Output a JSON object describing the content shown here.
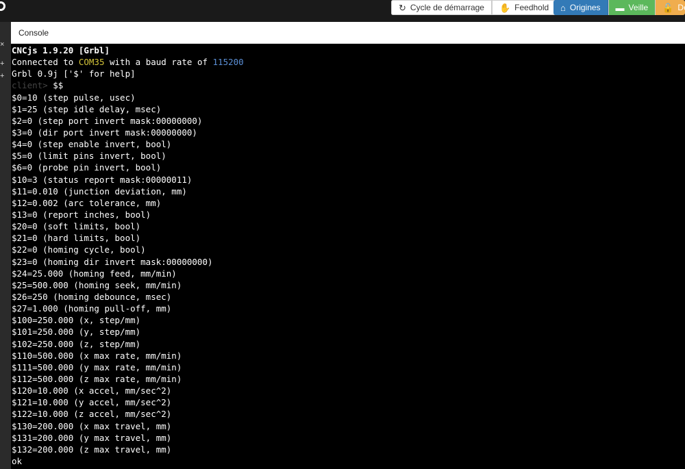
{
  "toolbar": {
    "cycle_label": "Cycle de démarrage",
    "feedhold_label": "Feedhold",
    "origins_label": "Origines",
    "sleep_label": "Veille",
    "unlock_label": "De"
  },
  "left_strip": {
    "glyphs": [
      "×",
      "+",
      "+"
    ]
  },
  "console": {
    "title": "Console",
    "header_line": "CNCjs 1.9.20 [Grbl]",
    "connection": {
      "prefix": "Connected to ",
      "port": "COM35",
      "middle": " with a baud rate of ",
      "baud": "115200"
    },
    "grbl_line": "Grbl 0.9j ['$' for help]",
    "prompt": {
      "label": "client>",
      "command": " $$"
    },
    "settings": [
      "$0=10 (step pulse, usec)",
      "$1=25 (step idle delay, msec)",
      "$2=0 (step port invert mask:00000000)",
      "$3=0 (dir port invert mask:00000000)",
      "$4=0 (step enable invert, bool)",
      "$5=0 (limit pins invert, bool)",
      "$6=0 (probe pin invert, bool)",
      "$10=3 (status report mask:00000011)",
      "$11=0.010 (junction deviation, mm)",
      "$12=0.002 (arc tolerance, mm)",
      "$13=0 (report inches, bool)",
      "$20=0 (soft limits, bool)",
      "$21=0 (hard limits, bool)",
      "$22=0 (homing cycle, bool)",
      "$23=0 (homing dir invert mask:00000000)",
      "$24=25.000 (homing feed, mm/min)",
      "$25=500.000 (homing seek, mm/min)",
      "$26=250 (homing debounce, msec)",
      "$27=1.000 (homing pull-off, mm)",
      "$100=250.000 (x, step/mm)",
      "$101=250.000 (y, step/mm)",
      "$102=250.000 (z, step/mm)",
      "$110=500.000 (x max rate, mm/min)",
      "$111=500.000 (y max rate, mm/min)",
      "$112=500.000 (z max rate, mm/min)",
      "$120=10.000 (x accel, mm/sec^2)",
      "$121=10.000 (y accel, mm/sec^2)",
      "$122=10.000 (z accel, mm/sec^2)",
      "$130=200.000 (x max travel, mm)",
      "$131=200.000 (y max travel, mm)",
      "$132=200.000 (z max travel, mm)"
    ],
    "ok_line": "ok"
  },
  "colors": {
    "port": "#d4c43a",
    "baud": "#5b8fd6",
    "origins_button": "#337ab7",
    "sleep_button": "#5cb85c",
    "unlock_button": "#f0ad4e"
  },
  "icons": {
    "cycle": "refresh-icon",
    "feedhold": "hand-icon",
    "origins": "home-icon",
    "sleep": "bed-icon",
    "unlock": "unlock-icon"
  }
}
